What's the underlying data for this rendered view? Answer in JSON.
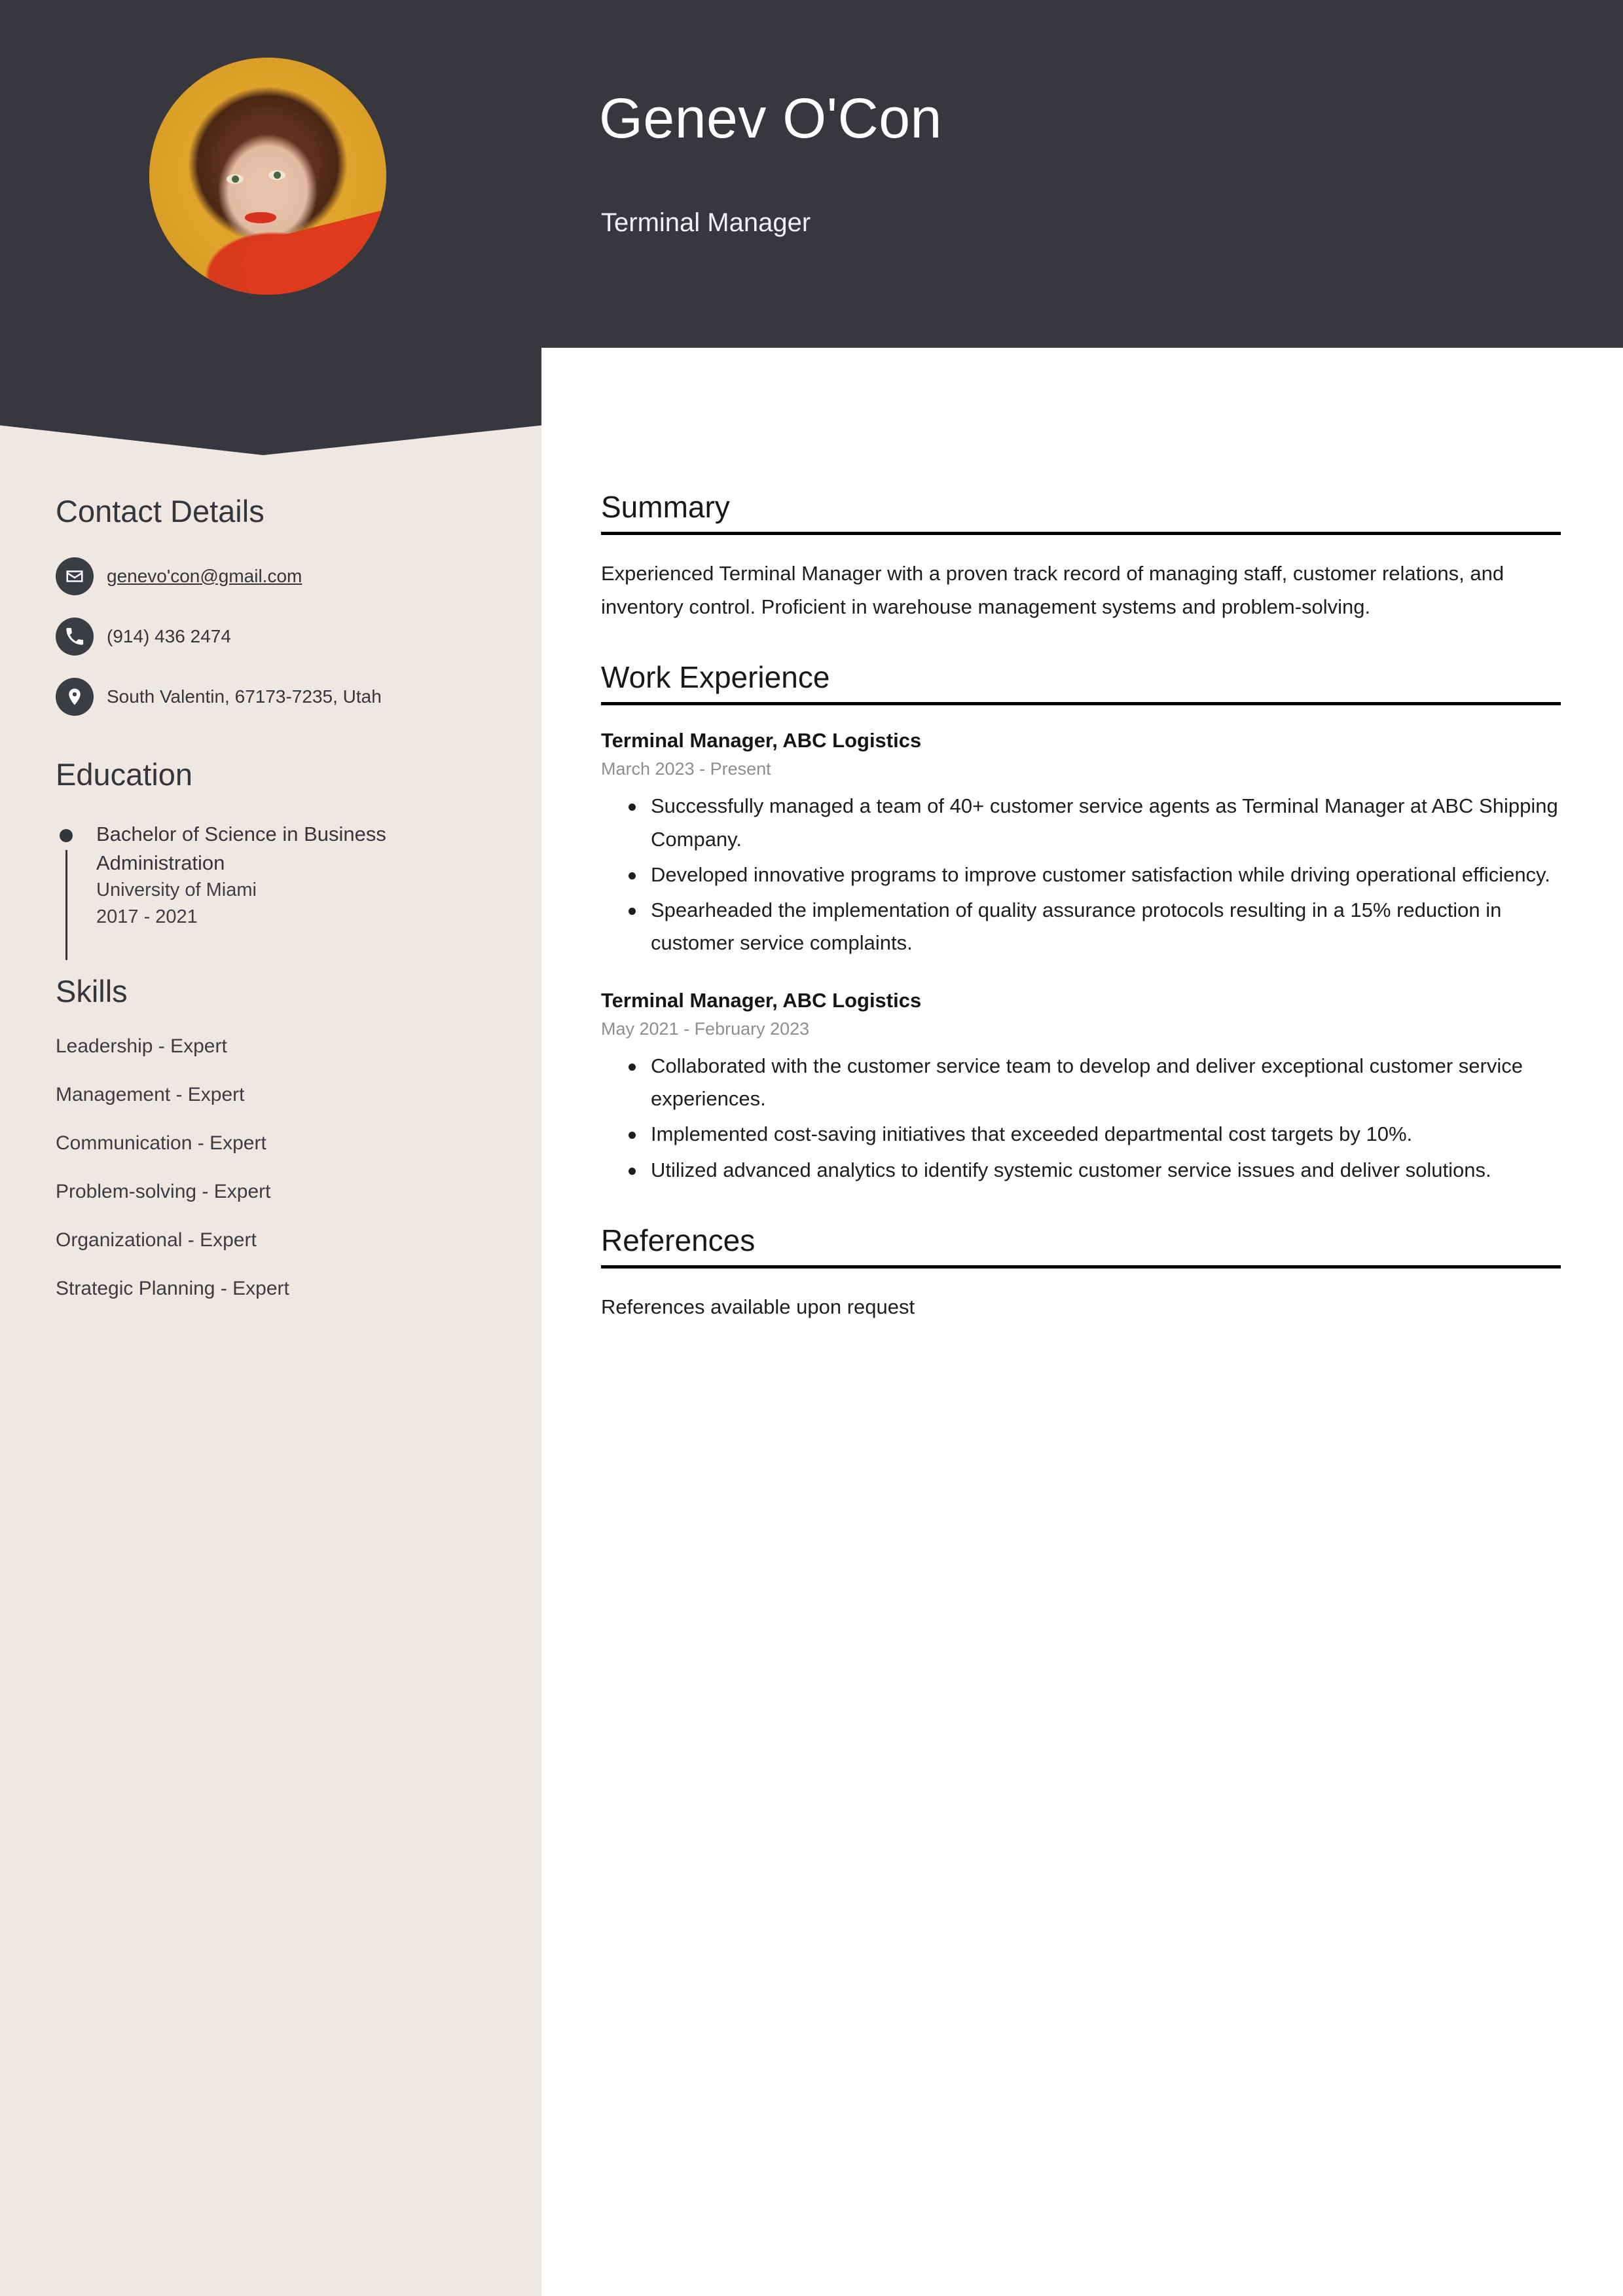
{
  "theme": {
    "header_bg": "#36383D",
    "sidebar_bg": "#EFE7E2",
    "page_bg": "#FFFFFF",
    "accent_dark": "#3A3D42",
    "rule_color": "#000000",
    "muted_text": "#8E8E92",
    "avatar_bg": "#E3A62C"
  },
  "header": {
    "name": "Genev O'Con",
    "job_title": "Terminal Manager",
    "avatar_alt": "portrait-photo"
  },
  "sidebar": {
    "contact": {
      "heading": "Contact Details",
      "items": [
        {
          "icon": "envelope-icon",
          "value": "genevo'con@gmail.com",
          "link": true
        },
        {
          "icon": "phone-icon",
          "value": "(914) 436 2474",
          "link": false
        },
        {
          "icon": "location-pin-icon",
          "value": "South Valentin, 67173-7235, Utah",
          "link": false
        }
      ]
    },
    "education": {
      "heading": "Education",
      "items": [
        {
          "degree": "Bachelor of Science in Business Administration",
          "school": "University of Miami",
          "dates": "2017 - 2021"
        }
      ]
    },
    "skills": {
      "heading": "Skills",
      "items": [
        "Leadership - Expert",
        "Management - Expert",
        "Communication - Expert",
        "Problem-solving - Expert",
        "Organizational - Expert",
        "Strategic Planning - Expert"
      ]
    }
  },
  "main": {
    "summary": {
      "heading": "Summary",
      "text": "Experienced Terminal Manager with a proven track record of managing staff, customer relations, and inventory control. Proficient in warehouse management systems and problem-solving."
    },
    "work_experience": {
      "heading": "Work Experience",
      "jobs": [
        {
          "role": "Terminal Manager, ABC Logistics",
          "dates": "March 2023 - Present",
          "bullets": [
            "Successfully managed a team of 40+ customer service agents as Terminal Manager at ABC Shipping Company.",
            "Developed innovative programs to improve customer satisfaction while driving operational efficiency.",
            "Spearheaded the implementation of quality assurance protocols resulting in a 15% reduction in customer service complaints."
          ]
        },
        {
          "role": "Terminal Manager, ABC Logistics",
          "dates": "May 2021 - February 2023",
          "bullets": [
            "Collaborated with the customer service team to develop and deliver exceptional customer service experiences.",
            "Implemented cost-saving initiatives that exceeded departmental cost targets by 10%.",
            "Utilized advanced analytics to identify systemic customer service issues and deliver solutions."
          ]
        }
      ]
    },
    "references": {
      "heading": "References",
      "text": "References available upon request"
    }
  }
}
